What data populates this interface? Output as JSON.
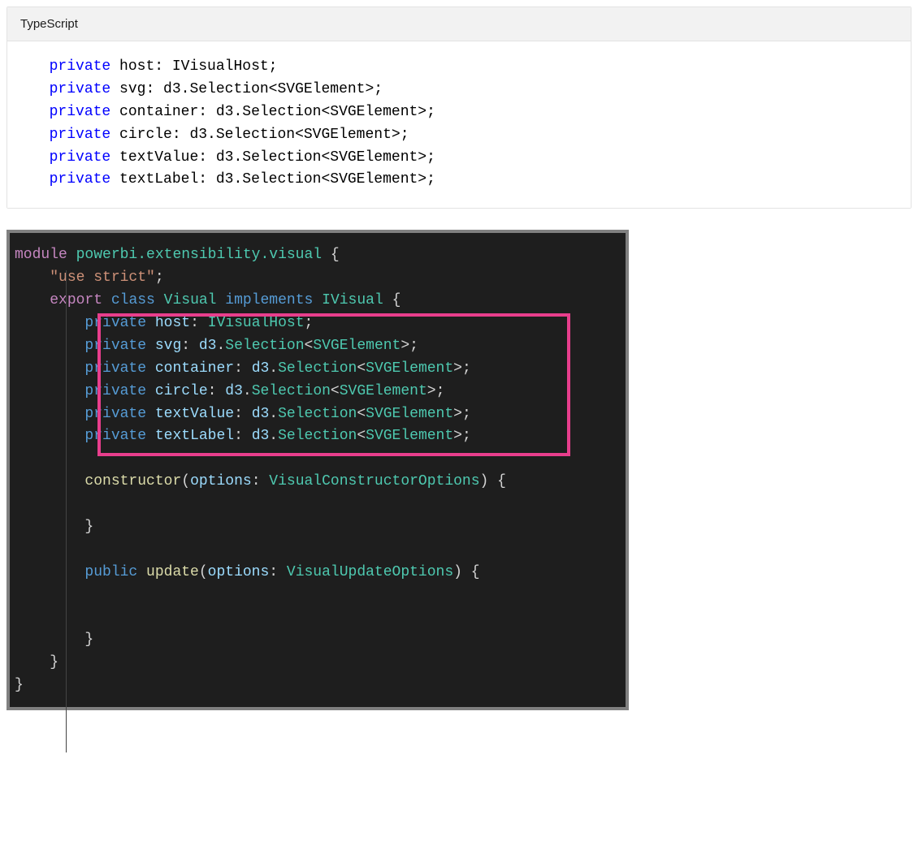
{
  "light_panel": {
    "language_label": "TypeScript",
    "lines": [
      {
        "pre": "  ",
        "kw": "private",
        "rest": " host: IVisualHost;"
      },
      {
        "pre": "  ",
        "kw": "private",
        "rest": " svg: d3.Selection<SVGElement>;"
      },
      {
        "pre": "  ",
        "kw": "private",
        "rest": " container: d3.Selection<SVGElement>;"
      },
      {
        "pre": "  ",
        "kw": "private",
        "rest": " circle: d3.Selection<SVGElement>;"
      },
      {
        "pre": "  ",
        "kw": "private",
        "rest": " textValue: d3.Selection<SVGElement>;"
      },
      {
        "pre": "  ",
        "kw": "private",
        "rest": " textLabel: d3.Selection<SVGElement>;"
      }
    ]
  },
  "dark_panel": {
    "l1": {
      "module": "module",
      "ns": "powerbi.extensibility.visual",
      "brace": " {"
    },
    "l2": {
      "indent": "    ",
      "str": "\"use strict\"",
      "semi": ";"
    },
    "l3": {
      "indent": "    ",
      "export": "export",
      "class": "class",
      "name": "Visual",
      "implements": "implements",
      "iface": "IVisual",
      "brace": " {"
    },
    "privs": [
      {
        "name": "host",
        "type": "IVisualHost",
        "d3": false
      },
      {
        "name": "svg",
        "type": "SVGElement",
        "d3": true
      },
      {
        "name": "container",
        "type": "SVGElement",
        "d3": true
      },
      {
        "name": "circle",
        "type": "SVGElement",
        "d3": true
      },
      {
        "name": "textValue",
        "type": "SVGElement",
        "d3": true
      },
      {
        "name": "textLabel",
        "type": "SVGElement",
        "d3": true
      }
    ],
    "ctor": {
      "indent": "        ",
      "fn": "constructor",
      "p": "options",
      "ptype": "VisualConstructorOptions"
    },
    "upd": {
      "indent": "        ",
      "pub": "public",
      "fn": "update",
      "p": "options",
      "ptype": "VisualUpdateOptions"
    },
    "close_brace": "}"
  }
}
